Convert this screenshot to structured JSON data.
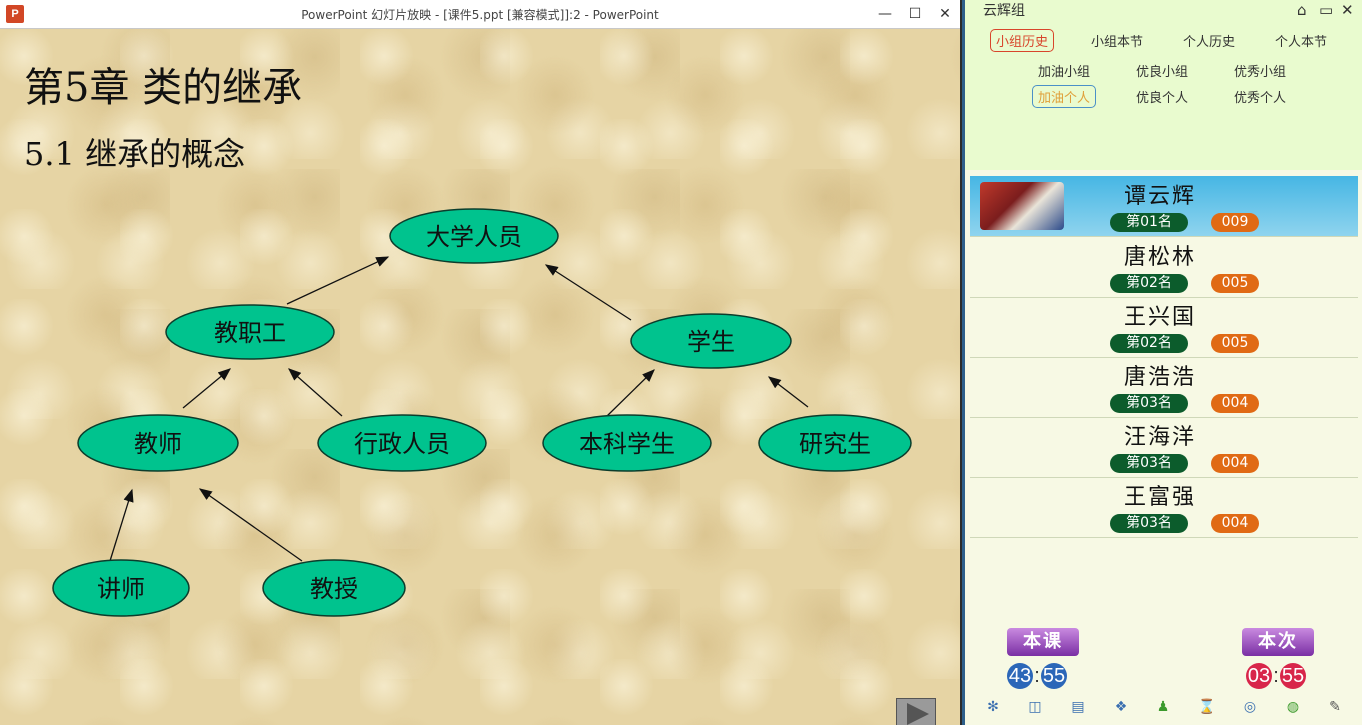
{
  "ppt": {
    "logo": "P",
    "window_title": "PowerPoint 幻灯片放映 - [课件5.ppt [兼容模式]]:2 - PowerPoint",
    "minimize": "—",
    "maximize": "☐",
    "close": "✕",
    "slide": {
      "heading": "第5章 类的继承",
      "subheading": "5.1 继承的概念",
      "nodes": {
        "university": "大学人员",
        "staff": "教职工",
        "student": "学生",
        "teacher": "教师",
        "admin": "行政人员",
        "undergrad": "本科学生",
        "graduate": "研究生",
        "lecturer": "讲师",
        "professor": "教授"
      },
      "node_color": "#00c38e"
    }
  },
  "panel": {
    "title": "云辉组",
    "tabs_row1": [
      "小组历史",
      "小组本节",
      "个人历史",
      "个人本节"
    ],
    "tabs_row2": [
      "加油小组",
      "优良小组",
      "优秀小组"
    ],
    "tabs_row3": [
      "加油个人",
      "优良个人",
      "优秀个人"
    ],
    "students": [
      {
        "name": "谭云辉",
        "rank": "第01名",
        "score": "009"
      },
      {
        "name": "唐松林",
        "rank": "第02名",
        "score": "005"
      },
      {
        "name": "王兴国",
        "rank": "第02名",
        "score": "005"
      },
      {
        "name": "唐浩浩",
        "rank": "第03名",
        "score": "004"
      },
      {
        "name": "汪海洋",
        "rank": "第03名",
        "score": "004"
      },
      {
        "name": "王富强",
        "rank": "第03名",
        "score": "004"
      }
    ],
    "lesson_badge": "本课",
    "session_badge": "本次",
    "lesson_timer": {
      "min": "43",
      "sep": ":",
      "sec": "55"
    },
    "session_timer": {
      "min": "03",
      "sep": ":",
      "sec": "55"
    },
    "colors": {
      "rank_bg": "#0c5c2c",
      "score_bg": "#e06a14",
      "selected_row": "#46b6e4"
    }
  }
}
